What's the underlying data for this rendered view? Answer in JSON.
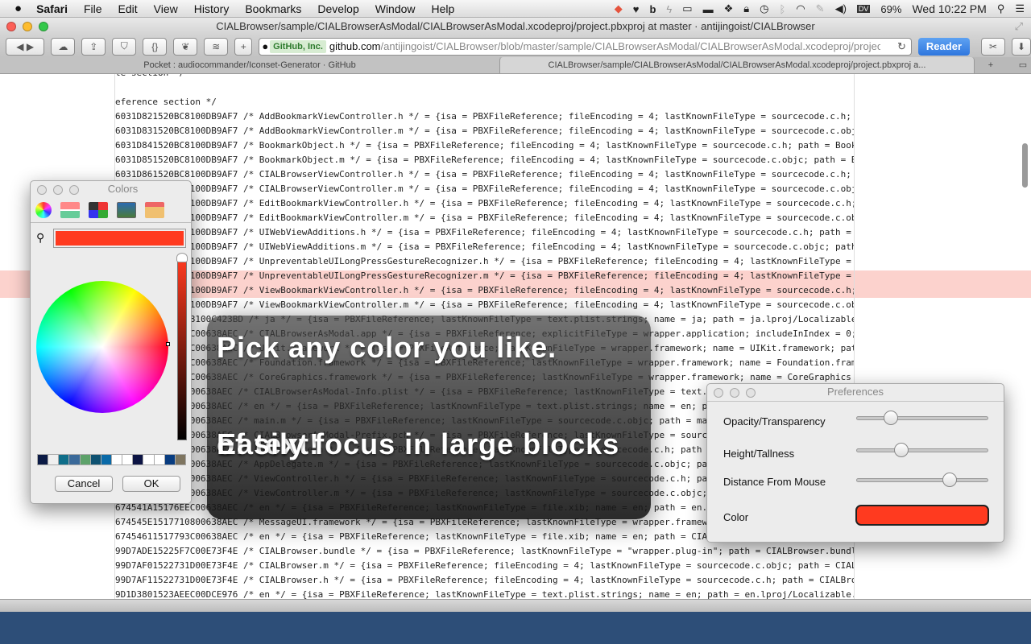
{
  "menubar": {
    "apple": "",
    "items": [
      "Safari",
      "File",
      "Edit",
      "View",
      "History",
      "Bookmarks",
      "Develop",
      "Window",
      "Help"
    ],
    "status_icons": [
      "pocket-icon",
      "heart-icon",
      "b-icon",
      "bolt-icon",
      "airplay-icon",
      "memory-icon",
      "dropbox-icon",
      "lock-icon",
      "time-machine-icon",
      "bluetooth-icon",
      "wifi-icon",
      "pen-icon",
      "volume-icon"
    ],
    "dv": "DV",
    "battery": "69%",
    "clock": "Wed 10:22 PM"
  },
  "window": {
    "title": "CIALBrowser/sample/CIALBrowserAsModal/CIALBrowserAsModal.xcodeproj/project.pbxproj at master · antijingoist/CIALBrowser",
    "address": {
      "ev_badge": "GitHub, Inc.",
      "host": "github.com",
      "path": "/antijingoist/CIALBrowser/blob/master/sample/CIALBrowserAsModal/CIALBrowserAsModal.xcodeproj/project.pbxproj",
      "reload": "↻"
    },
    "reader_label": "Reader",
    "tabs": [
      {
        "label": "Pocket : audiocommander/Iconset-Generator · GitHub",
        "active": false
      },
      {
        "label": "CIALBrowser/sample/CIALBrowserAsModal/CIALBrowserAsModal.xcodeproj/project.pbxproj a...",
        "active": true
      }
    ],
    "new_tab": "+"
  },
  "code_lines": [
    "le section */",
    "",
    "eference section */",
    "6031D821520BC8100DB9AF7 /* AddBookmarkViewController.h */ = {isa = PBXFileReference; fileEncoding = 4; lastKnownFileType = sourcecode.c.h; path = AddBookmarkViewController.h;",
    "6031D831520BC8100DB9AF7 /* AddBookmarkViewController.m */ = {isa = PBXFileReference; fileEncoding = 4; lastKnownFileType = sourcecode.c.objc; path = AddBookmarkViewController.m;",
    "6031D841520BC8100DB9AF7 /* BookmarkObject.h */ = {isa = PBXFileReference; fileEncoding = 4; lastKnownFileType = sourcecode.c.h; path = BookmarkObject.h;",
    "6031D851520BC8100DB9AF7 /* BookmarkObject.m */ = {isa = PBXFileReference; fileEncoding = 4; lastKnownFileType = sourcecode.c.objc; path = BookmarkObject.m;",
    "6031D861520BC8100DB9AF7 /* CIALBrowserViewController.h */ = {isa = PBXFileReference; fileEncoding = 4; lastKnownFileType = sourcecode.c.h;",
    "6031D871520BC8100DB9AF7 /* CIALBrowserViewController.m */ = {isa = PBXFileReference; fileEncoding = 4; lastKnownFileType = sourcecode.c.objc;",
    "6031D881520BC8100DB9AF7 /* EditBookmarkViewController.h */ = {isa = PBXFileReference; fileEncoding = 4; lastKnownFileType = sourcecode.c.h;",
    "6031D891520BC8100DB9AF7 /* EditBookmarkViewController.m */ = {isa = PBXFileReference; fileEncoding = 4; lastKnownFileType = sourcecode.c.objc;",
    "6031D8A1520BC8100DB9AF7 /* UIWebViewAdditions.h */ = {isa = PBXFileReference; fileEncoding = 4; lastKnownFileType = sourcecode.c.h; path =",
    "6031D8B1520BC8100DB9AF7 /* UIWebViewAdditions.m */ = {isa = PBXFileReference; fileEncoding = 4; lastKnownFileType = sourcecode.c.objc; path",
    "6031D8C1520BC8100DB9AF7 /* UnpreventableUILongPressGestureRecognizer.h */ = {isa = PBXFileReference; fileEncoding = 4; lastKnownFileType =",
    "6031D8D1520BC8100DB9AF7 /* UnpreventableUILongPressGestureRecognizer.m */ = {isa = PBXFileReference; fileEncoding = 4; lastKnownFileType =",
    "6031D8E1520BC8100DB9AF7 /* ViewBookmarkViewController.h */ = {isa = PBXFileReference; fileEncoding = 4; lastKnownFileType = sourcecode.c.h;",
    "6031D8F1520BC8100DB9AF7 /* ViewBookmarkViewController.m */ = {isa = PBXFileReference; fileEncoding = 4; lastKnownFileType = sourcecode.c.objc;",
    "6031D9011520BC8100C423BD /* ja */ = {isa = PBXFileReference; lastKnownFileType = text.plist.strings; name = ja; path = ja.lproj/Localizable.strings;",
    "67453F71517710C00638AEC /* CIALBrowserAsModal.app */ = {isa = PBXFileReference; explicitFileType = wrapper.application; includeInIndex = 0;",
    "67453FA1517710C00638AEC /* UIKit.framework */ = {isa = PBXFileReference; lastKnownFileType = wrapper.framework; name = UIKit.framework; path",
    "67453FC1517710C00638AEC /* Foundation.framework */ = {isa = PBXFileReference; lastKnownFileType = wrapper.framework; name = Foundation.framework;",
    "67453FE1517710C00638AEC /* CoreGraphics.framework */ = {isa = PBXFileReference; lastKnownFileType = wrapper.framework; name = CoreGraphics",
    "6745401517710C00638AEC /* CIALBrowserAsModal-Info.plist */ = {isa = PBXFileReference; lastKnownFileType = text.plist.xml;",
    "6745441517710C00638AEC /* en */ = {isa = PBXFileReference; lastKnownFileType = text.plist.strings; name = en; path = en.lproj/InfoPlist.strings;",
    "6745461517710C00638AEC /* main.m */ = {isa = PBXFileReference; lastKnownFileType = sourcecode.c.objc; path = main.m;",
    "6745481517710C00638AEC /* CIALBrowserAsModal-Prefix.pch */ = {isa = PBXFileReference; lastKnownFileType = sourcecode.c.h; path",
    "6745491517710C00638AEC /* AppDelegate.h */ = {isa = PBXFileReference; lastKnownFileType = sourcecode.c.h; path = AppDelegate.h;",
    "67454A1517710C00638AEC /* AppDelegate.m */ = {isa = PBXFileReference; lastKnownFileType = sourcecode.c.objc; path = AppDelegate.m;",
    "67454B1517710C00638AEC /* ViewController.h */ = {isa = PBXFileReference; lastKnownFileType = sourcecode.c.h; path = ViewController.h;",
    "67454C1517710C00638AEC /* ViewController.m */ = {isa = PBXFileReference; lastKnownFileType = sourcecode.c.objc; path = ViewController.m;",
    "674541A15176EEC00638AEC /* en */ = {isa = PBXFileReference; lastKnownFileType = file.xib; name = en; path = en.lproj/ViewController.xib;",
    "674545E1517710800638AEC /* MessageUI.framework */ = {isa = PBXFileReference; lastKnownFileType = wrapper.framework; name = MessageUI.framework;",
    "67454611517793C00638AEC /* en */ = {isa = PBXFileReference; lastKnownFileType = file.xib; name = en; path = CIALBrowser.xib;",
    "99D7ADE15225F7C00E73F4E /* CIALBrowser.bundle */ = {isa = PBXFileReference; lastKnownFileType = \"wrapper.plug-in\"; path = CIALBrowser.bundle;",
    "99D7AF01522731D00E73F4E /* CIALBrowser.m */ = {isa = PBXFileReference; fileEncoding = 4; lastKnownFileType = sourcecode.c.objc; path = CIALBrowser.m;",
    "99D7AF11522731D00E73F4E /* CIALBrowser.h */ = {isa = PBXFileReference; fileEncoding = 4; lastKnownFileType = sourcecode.c.h; path = CIALBrowser.h;",
    "9D1D3801523AEEC00DCE976 /* en */ = {isa = PBXFileReference; lastKnownFileType = text.plist.strings; name = en; path = en.lproj/Localizable.strings;"
  ],
  "hud": {
    "line1": "Pick any color you like.",
    "line2": "Easily focus in large blocks",
    "line3": "of text!"
  },
  "colors_panel": {
    "title": "Colors",
    "modes": [
      "color-wheel-icon",
      "sliders-icon",
      "palettes-icon",
      "image-palettes-icon",
      "crayons-icon"
    ],
    "current_color": "#ff3a1f",
    "swatches": [
      "#0b1a45",
      "#efefef",
      "#0f6e8a",
      "#3b6a9a",
      "#5da26a",
      "#0e5272",
      "#0a6aa8",
      "#ffffff",
      "#ffffff",
      "#0c1444",
      "#ffffff",
      "#ffffff",
      "#083c80",
      "#7e7560"
    ],
    "cancel_label": "Cancel",
    "ok_label": "OK"
  },
  "preferences": {
    "title": "Preferences",
    "opacity_label": "Opacity/Transparency",
    "opacity_value": 0.26,
    "height_label": "Height/Tallness",
    "height_value": 0.34,
    "distance_label": "Distance From Mouse",
    "distance_value": 0.71,
    "color_label": "Color",
    "color_value": "#ff3a1f"
  },
  "highlight_color": "#fcd2cd"
}
